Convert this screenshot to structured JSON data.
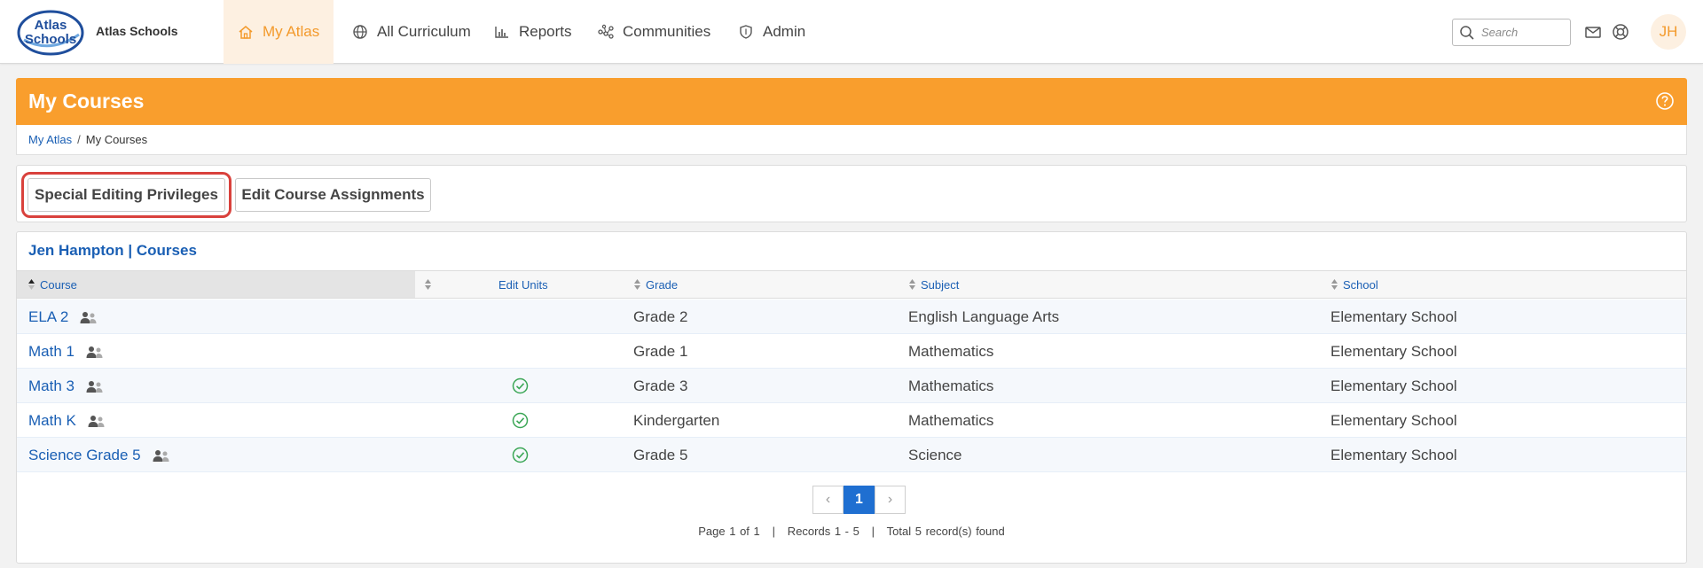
{
  "brand": {
    "logo_line1": "Atlas",
    "logo_line2": "Schools",
    "name": "Atlas Schools"
  },
  "nav": [
    {
      "label": "My Atlas",
      "icon": "home-icon",
      "active": true
    },
    {
      "label": "All Curriculum",
      "icon": "globe-icon"
    },
    {
      "label": "Reports",
      "icon": "bar-chart-icon"
    },
    {
      "label": "Communities",
      "icon": "network-icon"
    },
    {
      "label": "Admin",
      "icon": "shield-icon"
    }
  ],
  "search": {
    "placeholder": "Search"
  },
  "user": {
    "initials": "JH"
  },
  "page": {
    "title": "My Courses",
    "breadcrumb": {
      "root": "My Atlas",
      "separator": "/",
      "current": "My Courses"
    }
  },
  "actions": {
    "special_label": "Special Editing Privileges",
    "edit_label": "Edit Course Assignments"
  },
  "table": {
    "title": "Jen Hampton | Courses",
    "headers": {
      "course": "Course",
      "edit_units": "Edit Units",
      "grade": "Grade",
      "subject": "Subject",
      "school": "School"
    },
    "rows": [
      {
        "course": "ELA 2",
        "edit_units": false,
        "grade": "Grade 2",
        "subject": "English Language Arts",
        "school": "Elementary School"
      },
      {
        "course": "Math 1",
        "edit_units": false,
        "grade": "Grade 1",
        "subject": "Mathematics",
        "school": "Elementary School"
      },
      {
        "course": "Math 3",
        "edit_units": true,
        "grade": "Grade 3",
        "subject": "Mathematics",
        "school": "Elementary School"
      },
      {
        "course": "Math K",
        "edit_units": true,
        "grade": "Kindergarten",
        "subject": "Mathematics",
        "school": "Elementary School"
      },
      {
        "course": "Science Grade 5",
        "edit_units": true,
        "grade": "Grade 5",
        "subject": "Science",
        "school": "Elementary School"
      }
    ]
  },
  "pagination": {
    "prev": "‹",
    "current": "1",
    "next": "›",
    "info": "Page 1 of 1   |   Records 1 - 5   |   Total 5 record(s) found"
  },
  "colors": {
    "accent_orange": "#f99e2d",
    "link_blue": "#1a5fb4",
    "check_green": "#3aa655",
    "highlight_red": "#d9413c"
  }
}
